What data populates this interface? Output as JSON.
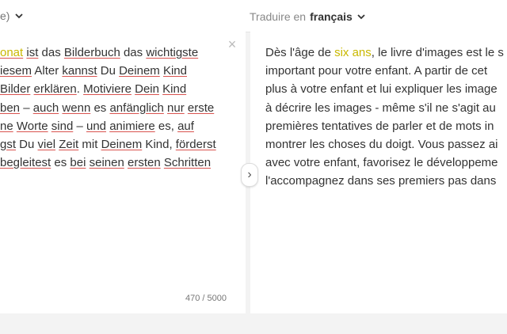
{
  "source": {
    "lang_label_fragment": "e)",
    "lines": [
      [
        {
          "t": "onat",
          "hl": true,
          "u": true
        },
        {
          "t": " "
        },
        {
          "t": "ist",
          "u": true
        },
        {
          "t": " das "
        },
        {
          "t": "Bilderbuch",
          "u": true
        },
        {
          "t": " das "
        },
        {
          "t": "wichtigste",
          "u": true
        }
      ],
      [
        {
          "t": "iesem",
          "u": true
        },
        {
          "t": " Alter "
        },
        {
          "t": "kannst",
          "u": true
        },
        {
          "t": " Du "
        },
        {
          "t": "Deinem",
          "u": true
        },
        {
          "t": " "
        },
        {
          "t": "Kind",
          "u": true
        }
      ],
      [
        {
          "t": "Bilder",
          "u": true
        },
        {
          "t": " "
        },
        {
          "t": "erklären",
          "u": true
        },
        {
          "t": ". "
        },
        {
          "t": "Motiviere",
          "u": true
        },
        {
          "t": " "
        },
        {
          "t": "Dein",
          "u": true
        },
        {
          "t": " "
        },
        {
          "t": "Kind",
          "u": true
        }
      ],
      [
        {
          "t": "ben",
          "u": true
        },
        {
          "t": " – "
        },
        {
          "t": "auch",
          "u": true
        },
        {
          "t": " "
        },
        {
          "t": "wenn",
          "u": true
        },
        {
          "t": " es "
        },
        {
          "t": "anfänglich",
          "u": true
        },
        {
          "t": " "
        },
        {
          "t": "nur",
          "u": true
        },
        {
          "t": " "
        },
        {
          "t": "erste",
          "u": true
        }
      ],
      [
        {
          "t": "ne",
          "u": true
        },
        {
          "t": " "
        },
        {
          "t": "Worte",
          "u": true
        },
        {
          "t": " "
        },
        {
          "t": "sind",
          "u": true
        },
        {
          "t": " – "
        },
        {
          "t": "und",
          "u": true
        },
        {
          "t": " "
        },
        {
          "t": "animiere",
          "u": true
        },
        {
          "t": " es, "
        },
        {
          "t": "auf",
          "u": true
        }
      ],
      [
        {
          "t": "gst",
          "u": true
        },
        {
          "t": " Du "
        },
        {
          "t": "viel",
          "u": true
        },
        {
          "t": " "
        },
        {
          "t": "Zeit",
          "u": true
        },
        {
          "t": " mit "
        },
        {
          "t": "Deinem",
          "u": true
        },
        {
          "t": " Kind, "
        },
        {
          "t": "förderst",
          "u": true
        }
      ],
      [
        {
          "t": "begleitest",
          "u": true
        },
        {
          "t": " es "
        },
        {
          "t": "bei",
          "u": true
        },
        {
          "t": " "
        },
        {
          "t": "seinen",
          "u": true
        },
        {
          "t": " "
        },
        {
          "t": "ersten",
          "u": true
        },
        {
          "t": " "
        },
        {
          "t": "Schritten",
          "u": true
        }
      ]
    ],
    "char_count": "470 / 5000",
    "clear_symbol": "×"
  },
  "target": {
    "translate_into": "Traduire en",
    "language": "français",
    "lines": [
      [
        {
          "t": "Dès l'âge de "
        },
        {
          "t": "six ans",
          "hl": true
        },
        {
          "t": ", le livre d'images est le s"
        }
      ],
      [
        {
          "t": "important pour votre enfant. A partir de cet"
        }
      ],
      [
        {
          "t": "plus à votre enfant et lui expliquer les image"
        }
      ],
      [
        {
          "t": "à décrire les images - même s'il ne s'agit au"
        }
      ],
      [
        {
          "t": "premières tentatives de parler et de mots in"
        }
      ],
      [
        {
          "t": "montrer les choses du doigt. Vous passez ai"
        }
      ],
      [
        {
          "t": "avec votre enfant, favorisez le développeme"
        }
      ],
      [
        {
          "t": "l'accompagnez dans ses premiers pas dans"
        }
      ]
    ]
  },
  "swap_symbol": "›",
  "icons": {
    "chevron": "chevron-down-icon",
    "close": "close-icon",
    "swap": "chevron-right-icon"
  },
  "colors": {
    "highlight": "#c9b800",
    "spell_underline": "#d9534f"
  }
}
